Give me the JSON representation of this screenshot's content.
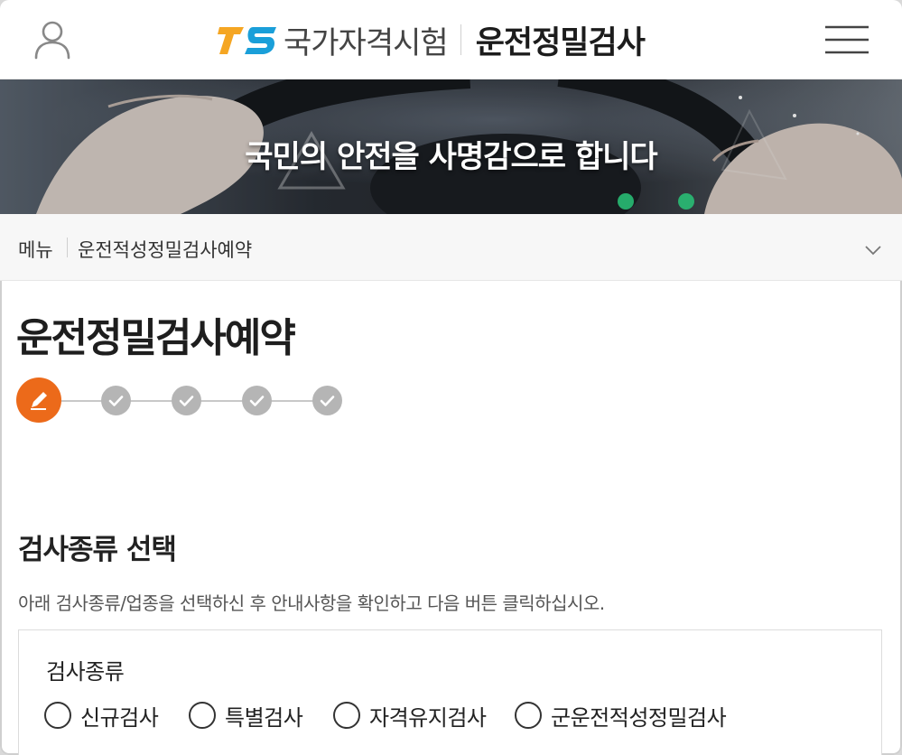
{
  "header": {
    "logo_mark": "TS",
    "org_name": "국가자격시험",
    "site_title": "운전정밀검사",
    "user_icon": "user-icon",
    "menu_icon": "hamburger-menu-icon"
  },
  "banner": {
    "slogan": "국민의 안전을 사명감으로 합니다"
  },
  "breadcrumb": {
    "home": "메뉴",
    "current": "운전적성정밀검사예약",
    "toggle_icon": "chevron-down-icon"
  },
  "page": {
    "title": "운전정밀검사예약"
  },
  "steps": {
    "total": 5,
    "current": 1,
    "active_icon": "pencil-icon",
    "done_icon": "check-icon"
  },
  "section": {
    "title": "검사종류 선택",
    "description": "아래 검사종류/업종을 선택하신 후 안내사항을 확인하고 다음 버튼 클릭하십시오.",
    "field_label": "검사종류",
    "options": [
      {
        "label": "신규검사",
        "selected": false
      },
      {
        "label": "특별검사",
        "selected": false
      },
      {
        "label": "자격유지검사",
        "selected": false
      },
      {
        "label": "군운전적성정밀검사",
        "selected": false
      }
    ]
  },
  "colors": {
    "accent": "#ec6a1a",
    "logo_t": "#f5a623",
    "logo_s": "#1a9fd9",
    "step_done": "#b5b5b5"
  }
}
